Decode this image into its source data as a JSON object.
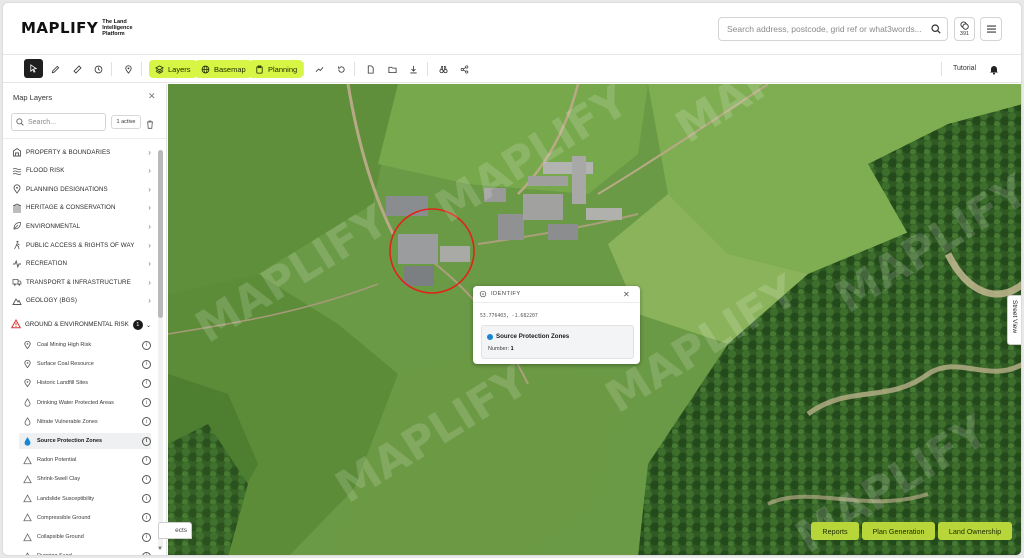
{
  "header": {
    "logo_text": "MAPLIFY",
    "logo_tagline": "The Land Intelligence Platform",
    "search_placeholder": "Search address, postcode, grid ref or what3words...",
    "credits_count": "391"
  },
  "toolbar": {
    "layers_label": "Layers",
    "basemap_label": "Basemap",
    "planning_label": "Planning",
    "tutorial_label": "Tutorial",
    "accent_color": "#d7f545"
  },
  "sidebar": {
    "title": "Map Layers",
    "search_placeholder": "Search...",
    "active_badge": "1 active",
    "categories": [
      {
        "label": "Property & Boundaries",
        "icon": "building-icon"
      },
      {
        "label": "Flood Risk",
        "icon": "waves-icon"
      },
      {
        "label": "Planning Designations",
        "icon": "pin-icon"
      },
      {
        "label": "Heritage & Conservation",
        "icon": "landmark-icon"
      },
      {
        "label": "Environmental",
        "icon": "leaf-icon"
      },
      {
        "label": "Public Access & Rights of Way",
        "icon": "walking-icon"
      },
      {
        "label": "Recreation",
        "icon": "activity-icon"
      },
      {
        "label": "Transport & Infrastructure",
        "icon": "truck-icon"
      },
      {
        "label": "Geology (BGS)",
        "icon": "mountain-icon"
      }
    ],
    "open_category": {
      "label": "Ground & Environmental Risk",
      "count": "1",
      "icon": "warning-icon"
    },
    "sub_layers": [
      {
        "label": "Coal Mining High Risk",
        "icon": "pin-icon"
      },
      {
        "label": "Surface Coal Resource",
        "icon": "pin-icon"
      },
      {
        "label": "Historic Landfill Sites",
        "icon": "pin-icon"
      },
      {
        "label": "Drinking Water Protected Areas",
        "icon": "drop-icon"
      },
      {
        "label": "Nitrate Vulnerable Zones",
        "icon": "drop-icon"
      },
      {
        "label": "Source Protection Zones",
        "icon": "drop-icon",
        "selected": true
      },
      {
        "label": "Radon Potential",
        "icon": "warning-icon"
      },
      {
        "label": "Shrink-Swell Clay",
        "icon": "warning-icon"
      },
      {
        "label": "Landslide Susceptibility",
        "icon": "warning-icon"
      },
      {
        "label": "Compressible Ground",
        "icon": "warning-icon"
      },
      {
        "label": "Collapsible Ground",
        "icon": "warning-icon"
      },
      {
        "label": "Running Sand",
        "icon": "warning-icon"
      }
    ]
  },
  "map": {
    "street_view_label": "Street View",
    "bottom_tab_label": "ects",
    "watermark_text": "MAPLIFY",
    "identify": {
      "title": "IDENTIFY",
      "coordinates": "53.776403, -1.682207",
      "feature_name": "Source Protection Zones",
      "number_label": "Number:",
      "number_value": "1",
      "feature_color": "#1786d6"
    },
    "buttons": {
      "reports": "Reports",
      "plan_generation": "Plan Generation",
      "land_ownership": "Land Ownership"
    }
  }
}
